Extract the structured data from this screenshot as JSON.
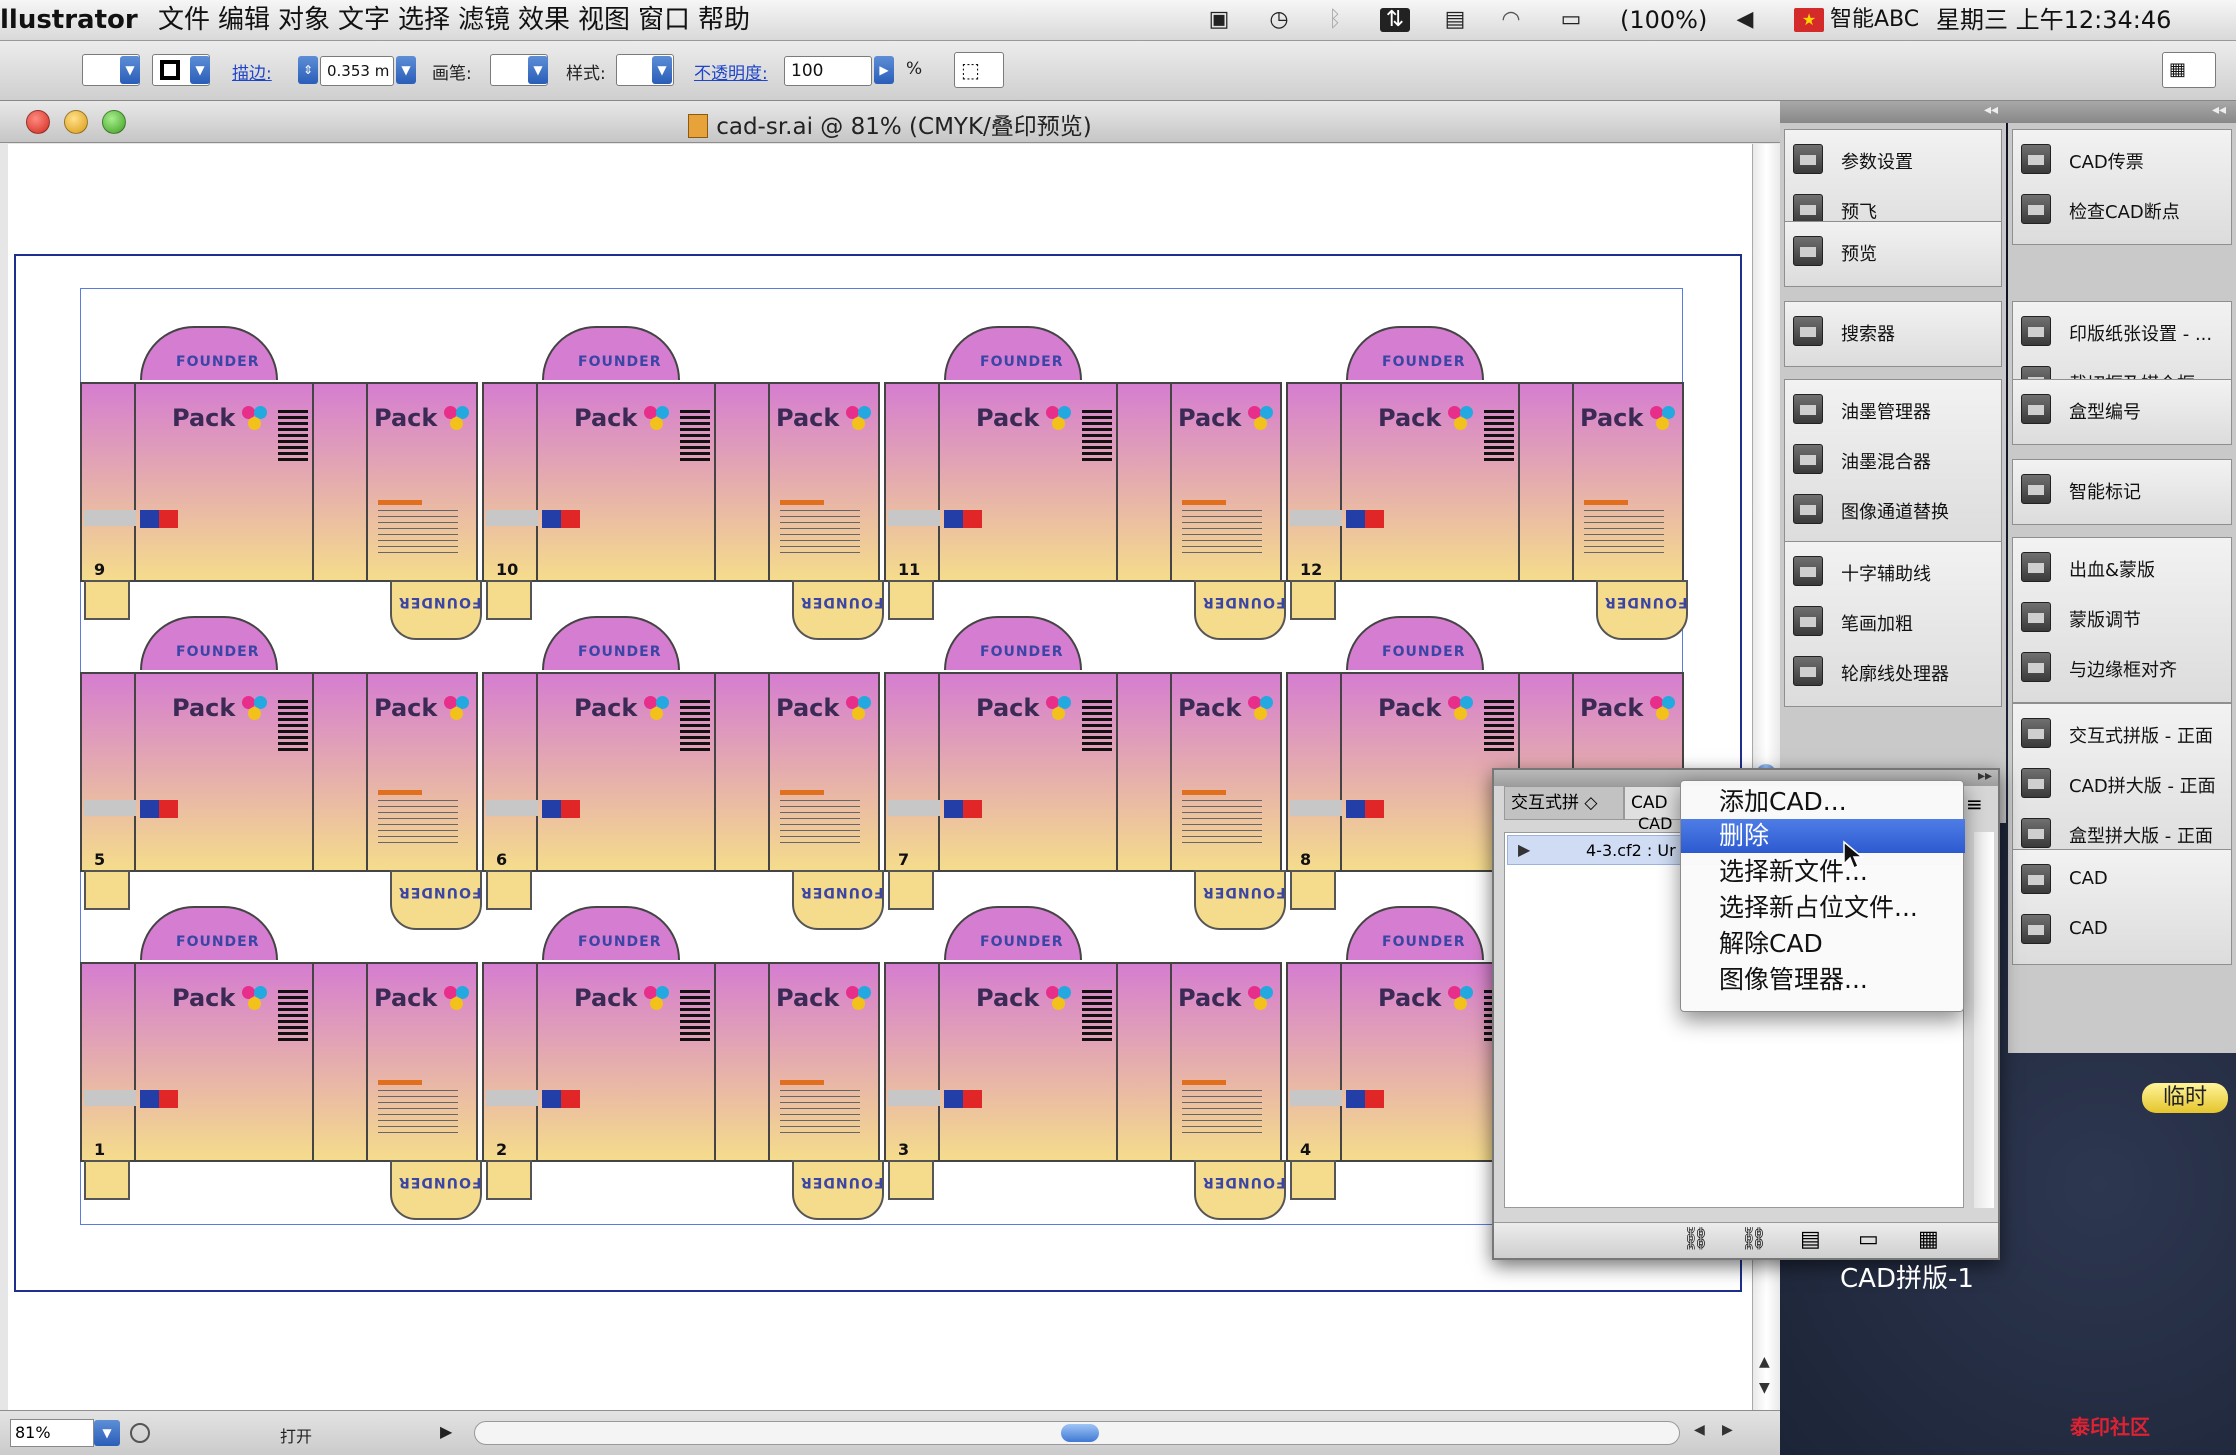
{
  "menubar": {
    "app_name": "llustrator",
    "menus": [
      "文件",
      "编辑",
      "对象",
      "文字",
      "选择",
      "滤镜",
      "效果",
      "视图",
      "窗口",
      "帮助"
    ],
    "battery": "(100%)",
    "input_method": "智能ABC",
    "clock": "星期三 上午12:34:46"
  },
  "control_bar": {
    "stroke_label": "描边:",
    "stroke_value": "0.353 m",
    "brush_label": "画笔:",
    "style_label": "样式:",
    "opacity_label": "不透明度:",
    "opacity_value": "100",
    "percent": "%"
  },
  "document": {
    "title": "cad-sr.ai @ 81% (CMYK/叠印预览)",
    "zoom": "81%",
    "status": "打开",
    "box_brand": "FOUNDER",
    "box_pack": "Pack",
    "box_numbers": [
      "9",
      "10",
      "11",
      "12",
      "5",
      "6",
      "7",
      "8",
      "1",
      "2",
      "3",
      "4"
    ],
    "accent_pink": "#d57dd0",
    "accent_yellow": "#f5dc8c"
  },
  "side_panels": {
    "col1_groups": [
      [
        "参数设置",
        "预飞"
      ],
      [
        "预览"
      ],
      [
        "搜索器"
      ],
      [
        "油墨管理器",
        "油墨混合器",
        "图像通道替换"
      ],
      [
        "十字辅助线",
        "笔画加粗",
        "轮廓线处理器"
      ]
    ],
    "col2_groups": [
      [
        "CAD传票",
        "检查CAD断点"
      ],
      [
        "印版纸张设置 - ...",
        "裁切框及媒介框"
      ],
      [
        "盒型编号"
      ],
      [
        "智能标记"
      ],
      [
        "出血&蒙版",
        "蒙版调节",
        "与边缘框对齐"
      ],
      [
        "交互式拼版 - 正面",
        "CAD拼大版 - 正面",
        "盒型拼大版 - 正面"
      ],
      [
        "CAD",
        "CAD"
      ]
    ],
    "temp_badge": "临时"
  },
  "cad_panel": {
    "tab1": "交互式拼",
    "tab2": "CAD",
    "row_label": "4-3.cf2 : Ur",
    "caption": "CAD拼版-1"
  },
  "context_menu": {
    "items": [
      "添加CAD...",
      "删除",
      "选择新文件...",
      "选择新占位文件...",
      "解除CAD",
      "图像管理器..."
    ],
    "selected_index": 1
  },
  "watermark": "泰印社区"
}
